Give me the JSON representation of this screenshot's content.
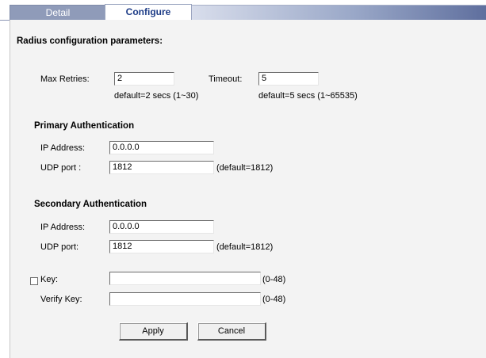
{
  "tabs": {
    "detail": "Detail",
    "configure": "Configure"
  },
  "section_title": "Radius configuration parameters:",
  "retries": {
    "label": "Max Retries:",
    "value": "2",
    "hint": "default=2 secs (1~30)"
  },
  "timeout": {
    "label": "Timeout:",
    "value": "5",
    "hint": "default=5 secs (1~65535)"
  },
  "primary": {
    "title": "Primary Authentication",
    "ip_label": "IP Address:",
    "ip_value": "0.0.0.0",
    "udp_label": "UDP port :",
    "udp_value": "1812",
    "udp_hint": "(default=1812)"
  },
  "secondary": {
    "title": "Secondary Authentication",
    "ip_label": "IP Address:",
    "ip_value": "0.0.0.0",
    "udp_label": "UDP port:",
    "udp_value": "1812",
    "udp_hint": "(default=1812)"
  },
  "key": {
    "label": "Key:",
    "value": "",
    "hint": "(0-48)",
    "checked": false
  },
  "verify_key": {
    "label": "Verify Key:",
    "value": "",
    "hint": "(0-48)"
  },
  "buttons": {
    "apply": "Apply",
    "cancel": "Cancel"
  }
}
